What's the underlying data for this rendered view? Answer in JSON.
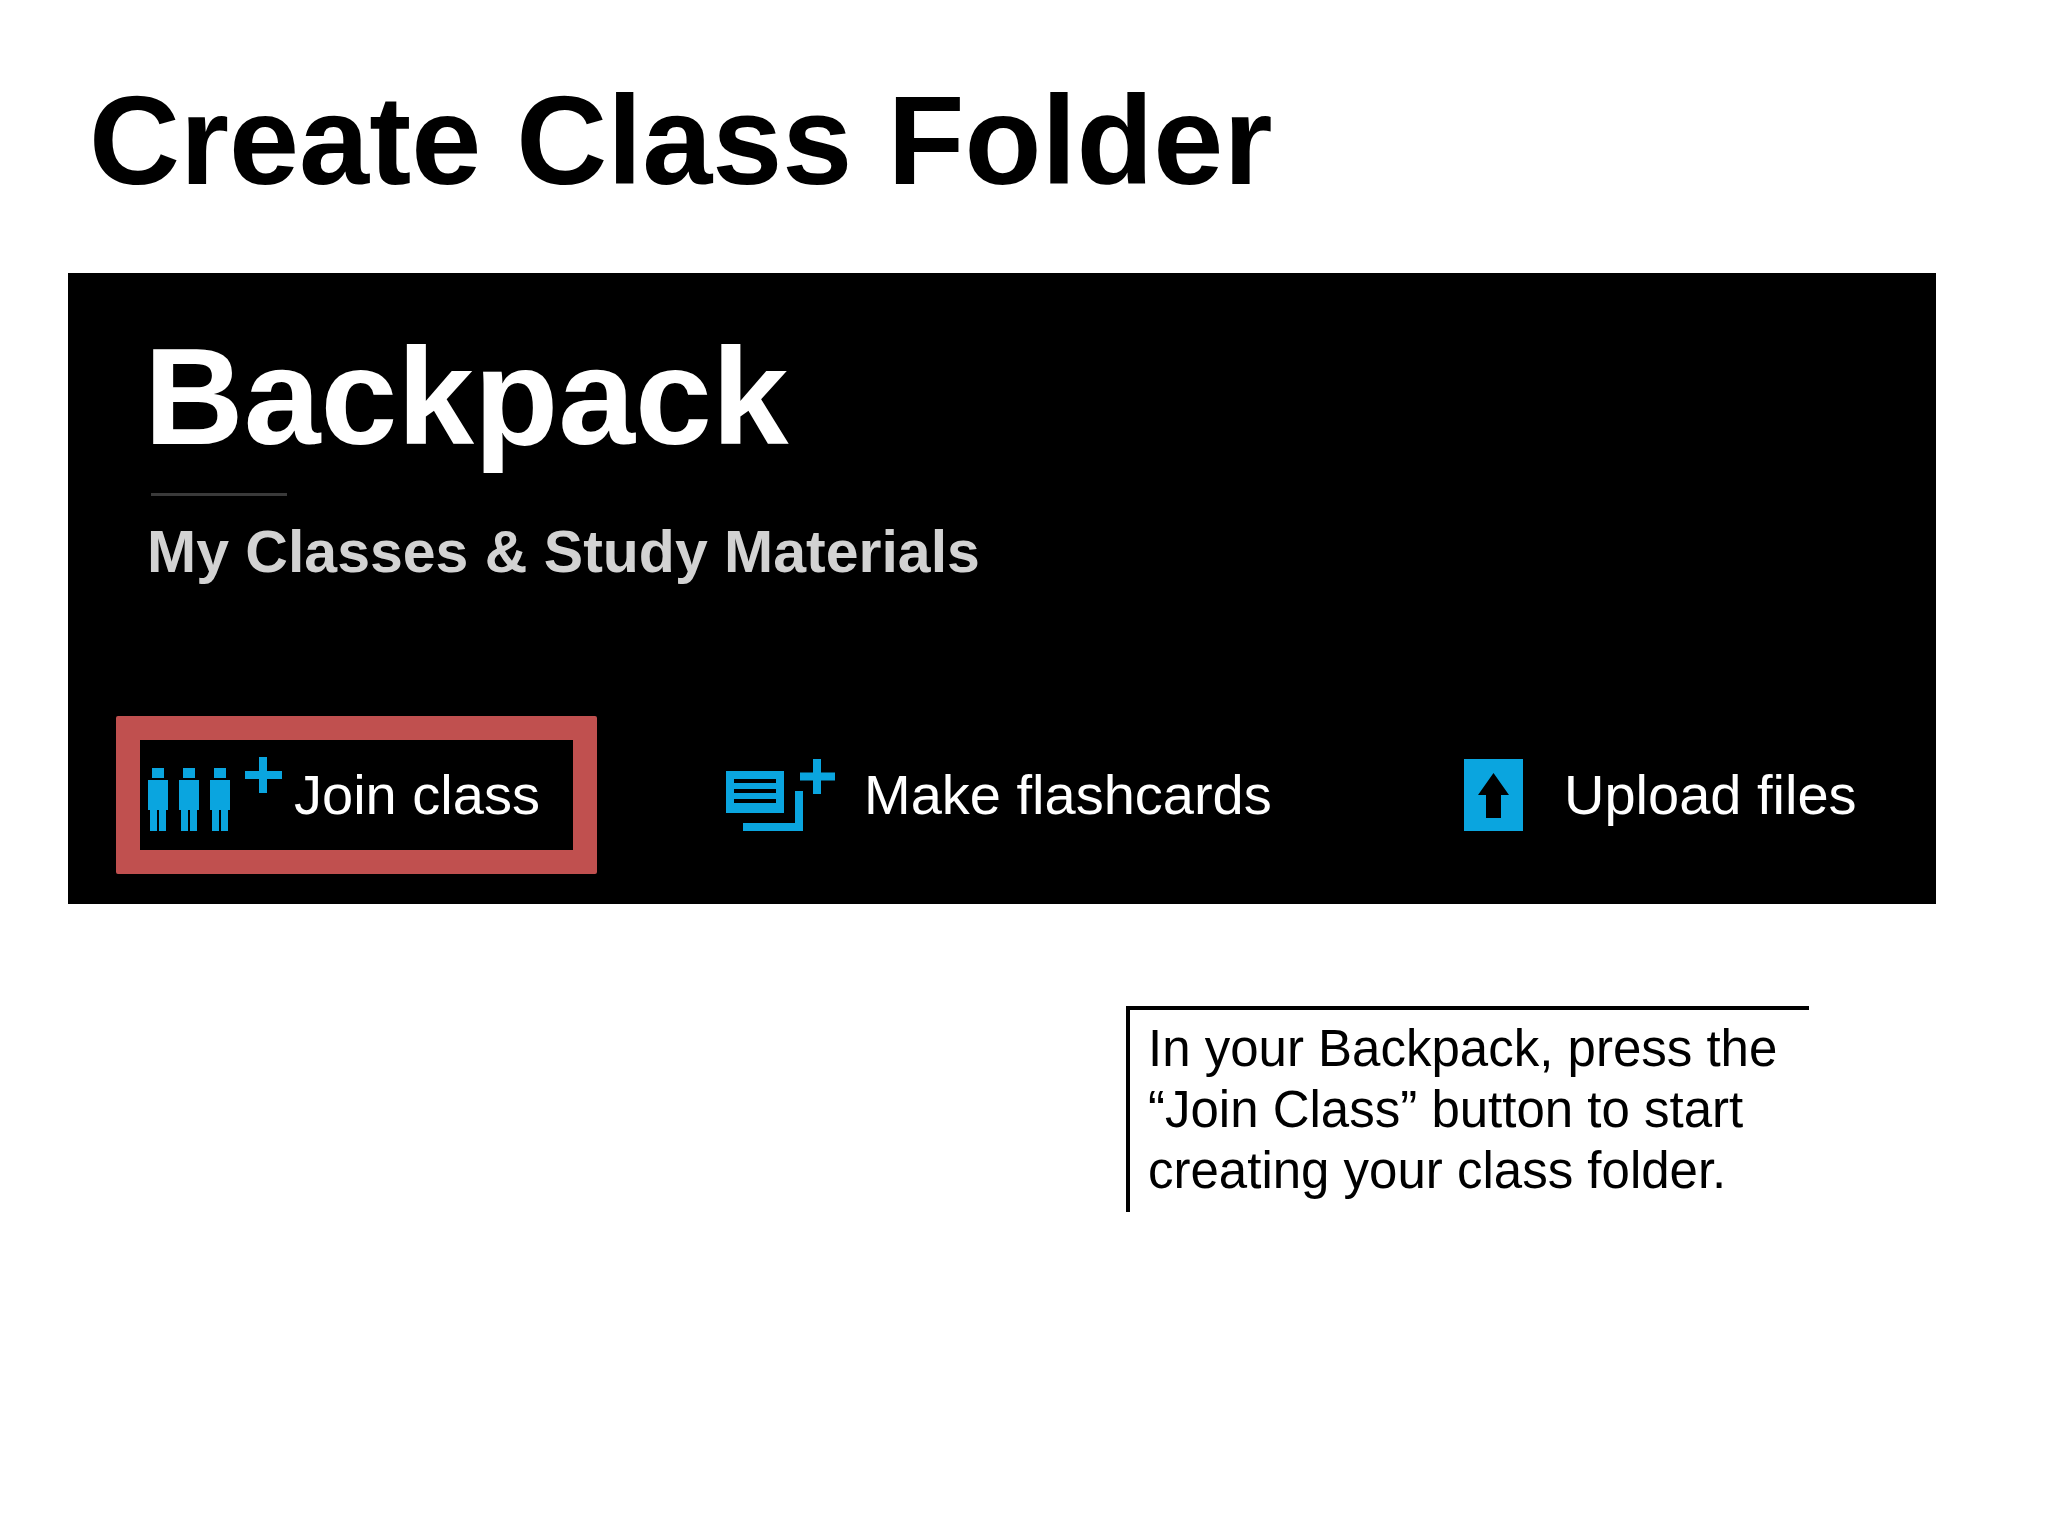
{
  "title": "Create Class Folder",
  "backpack": {
    "heading": "Backpack",
    "subheading": "My Classes & Study Materials",
    "actions": [
      {
        "kind": "join",
        "label": "Join class",
        "highlighted": true
      },
      {
        "kind": "flashcards",
        "label": "Make flashcards",
        "highlighted": false
      },
      {
        "kind": "upload",
        "label": "Upload files",
        "highlighted": false
      }
    ]
  },
  "callout": {
    "text": "In your Backpack, press the “Join Class” button to start creating your class folder."
  }
}
